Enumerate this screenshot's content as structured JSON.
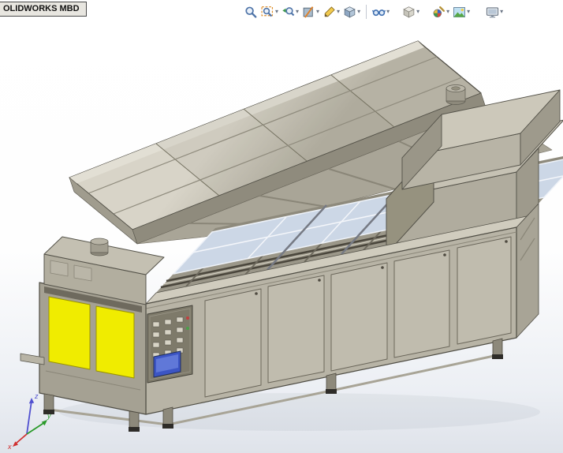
{
  "app": {
    "banner_label": "OLIDWORKS MBD"
  },
  "toolbar": {
    "dropdown_glyph": "▾",
    "icons": [
      {
        "name": "zoom-to-fit",
        "dropdown": false
      },
      {
        "name": "zoom-to-area",
        "dropdown": true
      },
      {
        "name": "previous-view",
        "dropdown": true
      },
      {
        "name": "section-view",
        "dropdown": true
      },
      {
        "name": "annotation-views",
        "dropdown": true
      },
      {
        "name": "display-style",
        "dropdown": true
      },
      {
        "name": "hide-show-items",
        "dropdown": true
      },
      {
        "name": "view-orientation",
        "dropdown": true
      },
      {
        "name": "edit-appearance",
        "dropdown": true
      },
      {
        "name": "apply-scene",
        "dropdown": true
      },
      {
        "name": "view-settings",
        "dropdown": true
      }
    ]
  },
  "triad": {
    "x_label": "x",
    "y_label": "y",
    "z_label": "z"
  },
  "colors": {
    "machine_body": "#bdb9ab",
    "machine_shadowed": "#a09c8e",
    "warning_yellow": "#f0ec00",
    "glass_blue": "#ccd7e6",
    "screen_blue": "#3c55c4",
    "viewport_gradient_bottom": "#dfe3ea"
  }
}
